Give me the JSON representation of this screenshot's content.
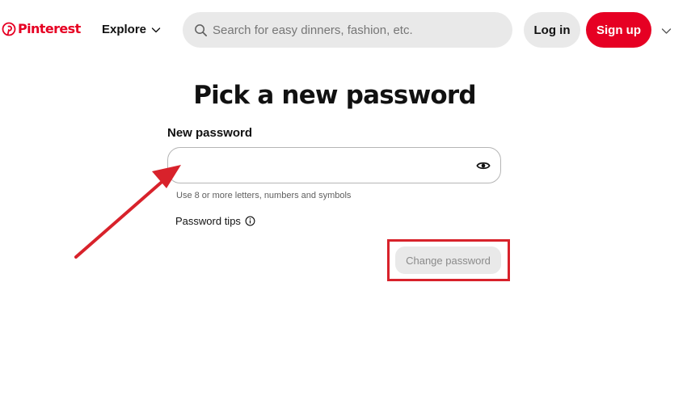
{
  "header": {
    "logo_text": "Pinterest",
    "explore_label": "Explore",
    "search_placeholder": "Search for easy dinners, fashion, etc.",
    "login_label": "Log in",
    "signup_label": "Sign up",
    "icons": {
      "logo": "pinterest-logo-icon",
      "explore_chevron": "chevron-down-icon",
      "search": "search-icon",
      "more": "chevron-down-icon"
    }
  },
  "main": {
    "title": "Pick a new password",
    "field_label": "New password",
    "password_value": "",
    "helper_text": "Use 8 or more letters, numbers and symbols",
    "tips_label": "Password tips",
    "change_button_label": "Change password",
    "icons": {
      "reveal": "eye-icon",
      "tips": "info-icon"
    }
  },
  "colors": {
    "brand": "#e60023",
    "annotation": "#d8222b",
    "button_gray": "#e9e9e9"
  }
}
